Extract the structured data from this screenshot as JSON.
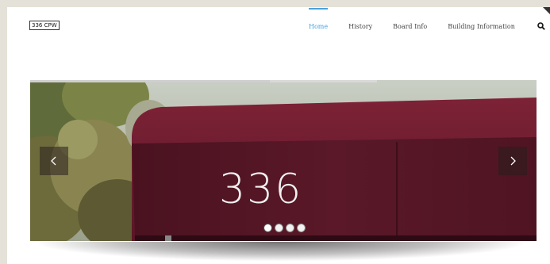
{
  "site": {
    "logo_text": "336 CPW"
  },
  "nav": {
    "items": [
      {
        "label": "Home",
        "active": true
      },
      {
        "label": "History",
        "active": false
      },
      {
        "label": "Board Info",
        "active": false
      },
      {
        "label": "Building Information",
        "active": false
      }
    ],
    "search_icon": "search-icon",
    "accent_color": "#4aa3df"
  },
  "slider": {
    "progress_fraction": 0.69,
    "slide_text": "336",
    "slide_count": 4,
    "active_slide": 1,
    "awning_color": "#6b1a2a",
    "prev_icon": "chevron-left-icon",
    "next_icon": "chevron-right-icon"
  }
}
